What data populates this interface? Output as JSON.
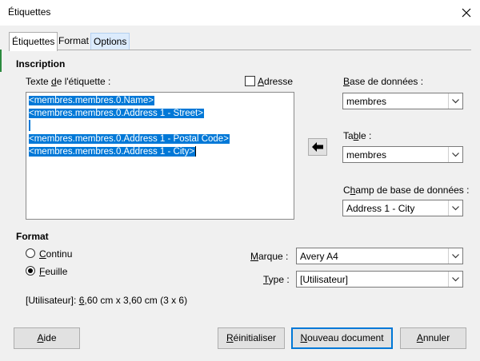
{
  "window": {
    "title": "Étiquettes",
    "close_glyph": "✕"
  },
  "tabs": [
    {
      "label": "Étiquettes"
    },
    {
      "label": "Format"
    },
    {
      "label": "Options"
    }
  ],
  "inscription": {
    "heading": "Inscription",
    "label_text_pre": "Texte ",
    "label_text_u": "d",
    "label_text_post": "e l'étiquette :",
    "address_checkbox": "Adresse",
    "lines": [
      "<membres.membres.0.Name>",
      "<membres.membres.0.Address 1 - Street>",
      "",
      "<membres.membres.0.Address 1 - Postal Code>",
      "<membres.membres.0.Address 1 - City>"
    ]
  },
  "database": {
    "db_label_u": "B",
    "db_label_rest": "ase de données :",
    "db_value": "membres",
    "table_label_pre": "Ta",
    "table_label_u": "b",
    "table_label_post": "le :",
    "table_value": "membres",
    "field_label_pre": "C",
    "field_label_u": "h",
    "field_label_post": "amp de base de données :",
    "field_value": "Address 1 - City"
  },
  "format": {
    "heading": "Format",
    "continu_u": "C",
    "continu_rest": "ontinu",
    "feuille_u": "F",
    "feuille_rest": "euille",
    "marque_u": "M",
    "marque_rest": "arque :",
    "marque_value": "Avery A4",
    "type_u": "T",
    "type_rest": "ype :",
    "type_value": "[Utilisateur]",
    "summary_pre": "[Utilisateur]: ",
    "summary_u": "6",
    "summary_post": ",60 cm x 3,60 cm (3 x 6)"
  },
  "buttons": {
    "aide_u": "A",
    "aide_rest": "ide",
    "reset_u": "R",
    "reset_rest": "éinitialiser",
    "new_u": "N",
    "new_rest": "ouveau document",
    "cancel_u": "A",
    "cancel_rest": "nnuler"
  }
}
